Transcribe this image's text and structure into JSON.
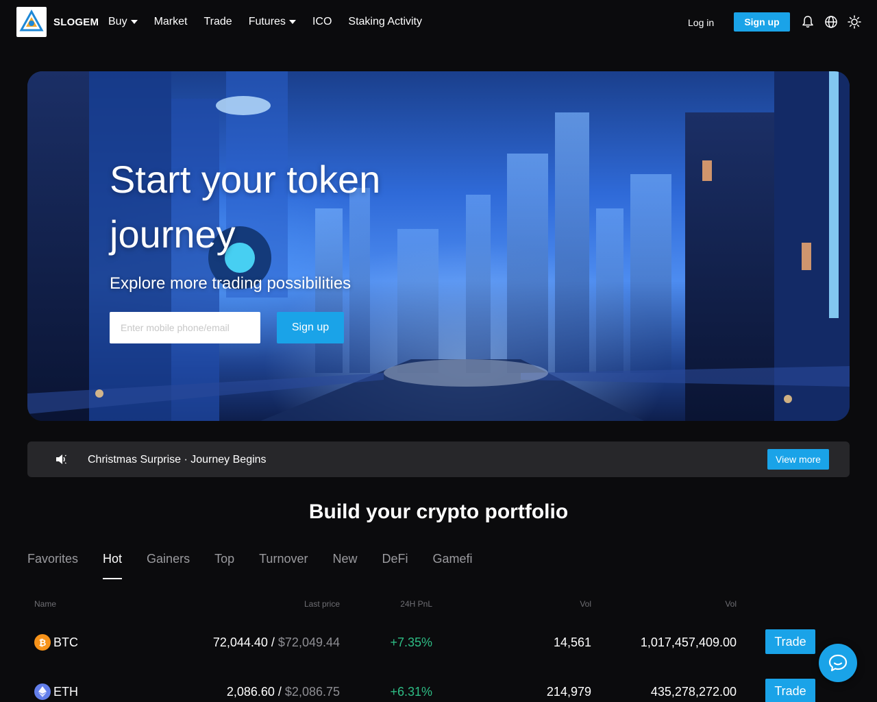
{
  "header": {
    "brand": "SLOGEM",
    "nav": [
      {
        "label": "Buy",
        "dropdown": true
      },
      {
        "label": "Market",
        "dropdown": false
      },
      {
        "label": "Trade",
        "dropdown": false
      },
      {
        "label": "Futures",
        "dropdown": true
      },
      {
        "label": "ICO",
        "dropdown": false
      },
      {
        "label": "Staking Activity",
        "dropdown": false
      }
    ],
    "login": "Log in",
    "signup": "Sign up",
    "icons": [
      "bell-icon",
      "globe-icon",
      "sun-icon"
    ]
  },
  "hero": {
    "title": "Start your token journey",
    "subtitle": "Explore more trading possibilities",
    "input_placeholder": "Enter mobile phone/email",
    "signup": "Sign up"
  },
  "notice": {
    "text": "Christmas Surprise · Journey Begins",
    "button": "View more"
  },
  "portfolio": {
    "title": "Build your crypto portfolio",
    "tabs": [
      "Favorites",
      "Hot",
      "Gainers",
      "Top",
      "Turnover",
      "New",
      "DeFi",
      "Gamefi"
    ],
    "active_tab": "Hot",
    "columns": [
      "Name",
      "Last price",
      "24H PnL",
      "Vol",
      "Vol"
    ],
    "rows": [
      {
        "coin": "BTC",
        "icon": "bitcoin-icon",
        "icon_color": "#f7931a",
        "price": "72,044.40",
        "usd": "$72,049.44",
        "pnl": "+7.35%",
        "vol": "14,561",
        "turnover": "1,017,457,409.00",
        "action": "Trade"
      },
      {
        "coin": "ETH",
        "icon": "ethereum-icon",
        "icon_color": "#627eea",
        "price": "2,086.60",
        "usd": "$2,086.75",
        "pnl": "+6.31%",
        "vol": "214,979",
        "turnover": "435,278,272.00",
        "action": "Trade"
      }
    ]
  },
  "colors": {
    "accent": "#1aa3e8",
    "background": "#0b0b0d",
    "positive": "#2ebd85"
  }
}
